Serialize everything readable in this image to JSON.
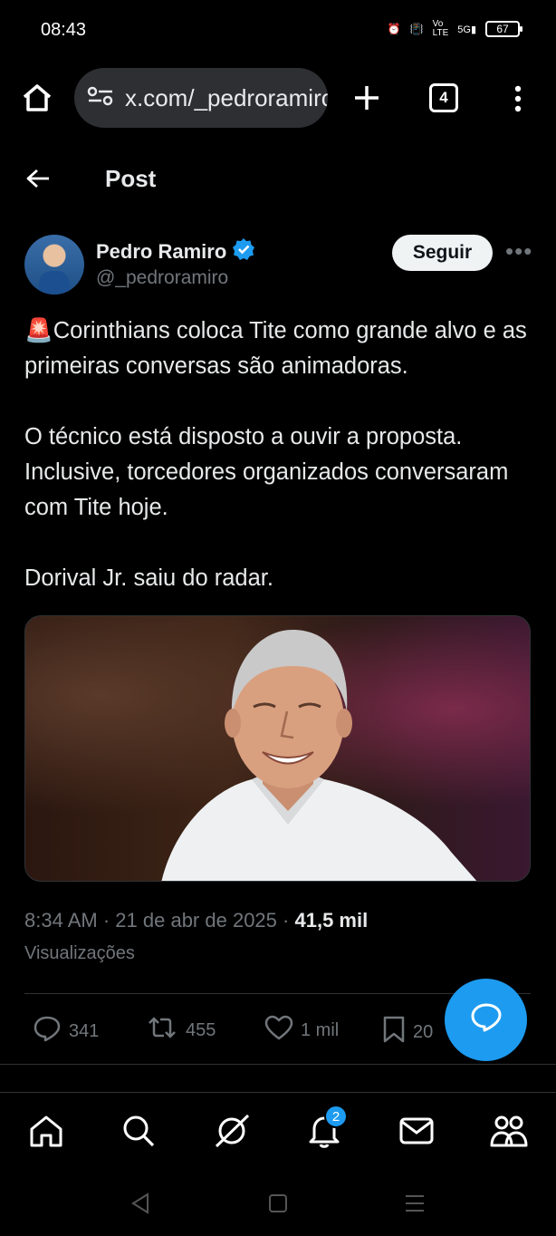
{
  "status_bar": {
    "time": "08:43",
    "battery": "67"
  },
  "browser": {
    "url": "x.com/_pedroramiro",
    "tab_count": "4"
  },
  "page": {
    "title": "Post"
  },
  "post": {
    "author_name": "Pedro Ramiro",
    "author_handle": "@_pedroramiro",
    "follow_label": "Seguir",
    "text_line1": "🚨Corinthians coloca Tite como grande alvo e as primeiras conversas são animadoras.",
    "text_line2": "O técnico está disposto a ouvir a proposta. Inclusive, torcedores organizados conversaram com Tite hoje.",
    "text_line3": "Dorival Jr. saiu do radar.",
    "time": "8:34 AM",
    "date": "21 de abr de 2025",
    "views_count": "41,5 mil",
    "views_label": "Visualizações",
    "verified_color": "#1d9bf0"
  },
  "actions": {
    "replies": "341",
    "reposts": "455",
    "likes": "1 mil",
    "bookmarks": "20"
  },
  "nav": {
    "notifications_badge": "2"
  }
}
